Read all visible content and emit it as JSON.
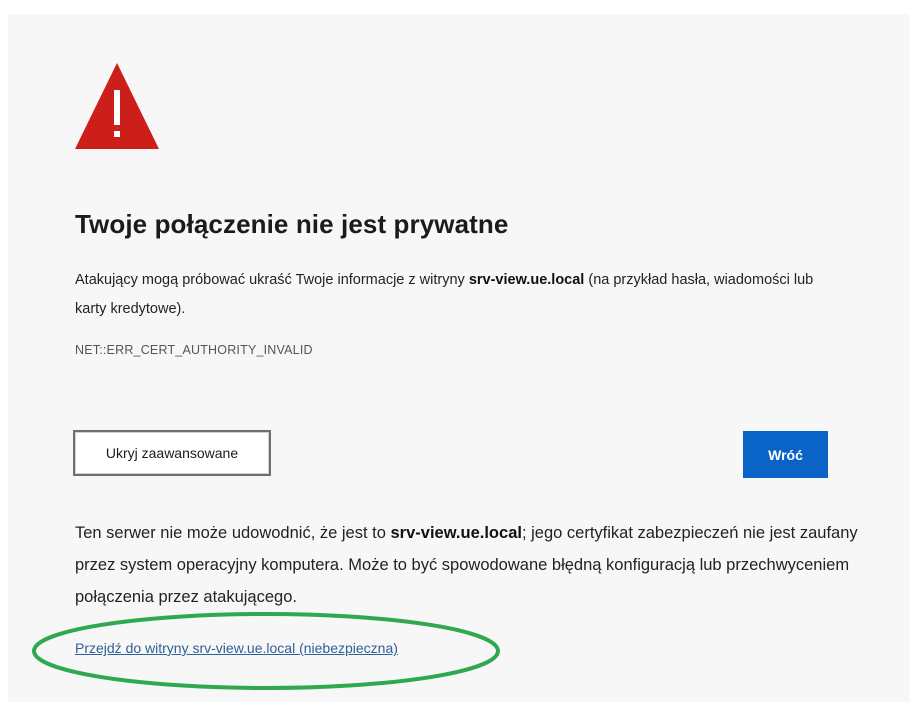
{
  "error_page": {
    "icon": "warning-triangle-icon",
    "title": "Twoje połączenie nie jest prywatne",
    "description": {
      "before": "Atakujący mogą próbować ukraść Twoje informacje z witryny ",
      "host": "srv-view.ue.local",
      "after": " (na przykład hasła, wiadomości lub karty kredytowe)."
    },
    "error_code": "NET::ERR_CERT_AUTHORITY_INVALID",
    "buttons": {
      "hide_advanced": "Ukryj zaawansowane",
      "back": "Wróć"
    },
    "details": {
      "before": "Ten serwer nie może udowodnić, że jest to ",
      "host": "srv-view.ue.local",
      "after": "; jego certyfikat zabezpieczeń nie jest zaufany przez system operacyjny komputera. Może to być spowodowane błędną konfiguracją lub przechwyceniem połączenia przez atakującego."
    },
    "proceed_link": "Przejdź do witryny srv-view.ue.local (niebezpieczna)"
  },
  "colors": {
    "warning_red": "#cc1f1a",
    "primary_button": "#0a63c6",
    "link": "#2e5f97",
    "annotation_green": "#2fa84f"
  }
}
